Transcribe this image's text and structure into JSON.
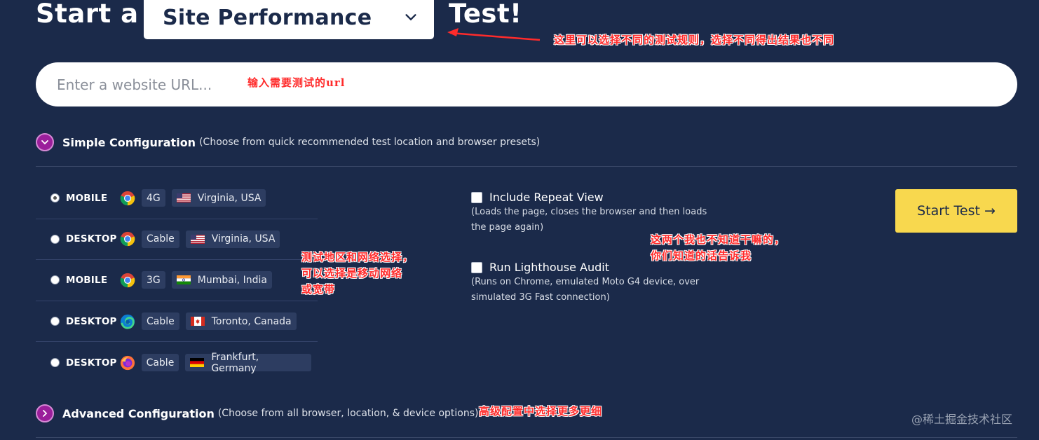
{
  "header": {
    "prefix": "Start a",
    "test_type": "Site Performance",
    "suffix": "Test!"
  },
  "url_input": {
    "placeholder": "Enter a website URL..."
  },
  "simple_config": {
    "title": "Simple Configuration",
    "subtitle": "(Choose from quick recommended test location and browser presets)"
  },
  "presets": [
    {
      "device": "MOBILE",
      "browser": "chrome-icon",
      "connection": "4G",
      "flag": "us-flag-icon",
      "location": "Virginia, USA",
      "selected": true
    },
    {
      "device": "DESKTOP",
      "browser": "chrome-icon",
      "connection": "Cable",
      "flag": "us-flag-icon",
      "location": "Virginia, USA",
      "selected": false
    },
    {
      "device": "MOBILE",
      "browser": "chrome-icon",
      "connection": "3G",
      "flag": "india-flag-icon",
      "location": "Mumbai, India",
      "selected": false
    },
    {
      "device": "DESKTOP",
      "browser": "edge-icon",
      "connection": "Cable",
      "flag": "canada-flag-icon",
      "location": "Toronto, Canada",
      "selected": false
    },
    {
      "device": "DESKTOP",
      "browser": "firefox-icon",
      "connection": "Cable",
      "flag": "germany-flag-icon",
      "location": "Frankfurt, Germany",
      "selected": false
    }
  ],
  "options": {
    "repeat_view": {
      "label": "Include Repeat View",
      "description": "(Loads the page, closes the browser and then loads the page again)"
    },
    "lighthouse": {
      "label": "Run Lighthouse Audit",
      "description": "(Runs on Chrome, emulated Moto G4 device, over simulated 3G Fast connection)"
    }
  },
  "start_button": "Start Test →",
  "advanced_config": {
    "title": "Advanced Configuration",
    "subtitle": "(Choose from all browser, location, & device options)"
  },
  "annotations": {
    "select_note": "这里可以选择不同的测试规则，选择不同得出结果也不同",
    "url_note": "输入需要测试的url",
    "presets_note": [
      "测试地区和网络选择，",
      "可以选择是移动网络",
      "或宽带"
    ],
    "options_note": [
      "这两个我也不知道干嘛的，",
      "你们知道的话告诉我"
    ],
    "advanced_note": "高级配置中选择更多更细"
  },
  "watermark": "@稀土掘金技术社区",
  "colors": {
    "background": "#1b2a4a",
    "accent_button": "#f8d84e",
    "toggle": "#9b1f9b",
    "annotation": "#ff2b2b"
  }
}
